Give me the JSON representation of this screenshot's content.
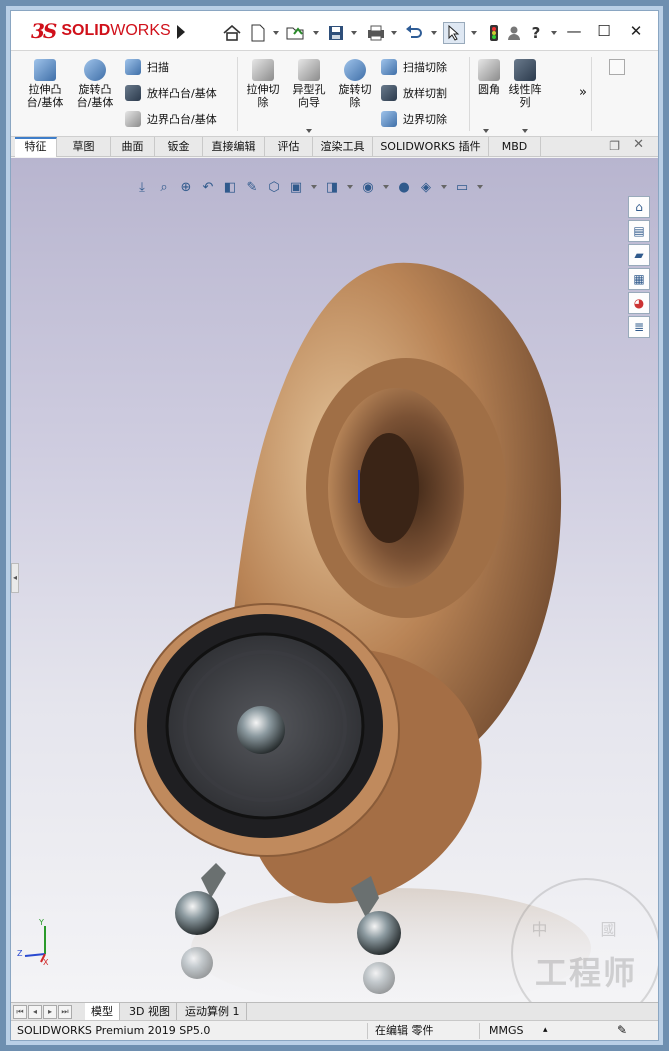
{
  "app": {
    "logo_mark": "3S",
    "logo_text_bold": "SOLID",
    "logo_text_light": "WORKS"
  },
  "quick_access": {
    "icons": [
      "home-icon",
      "new-document-icon",
      "open-icon",
      "save-icon",
      "print-icon",
      "undo-icon",
      "select-icon",
      "traffic-light-icon",
      "user-icon",
      "help-icon",
      "search-icon"
    ],
    "help_glyph": "?"
  },
  "window": {
    "minimize": "—",
    "maximize": "☐",
    "close": "✕"
  },
  "ribbon": {
    "extrude_boss": "拉伸凸\n台/基体",
    "revolve_boss": "旋转凸\n台/基体",
    "sweep": "扫描",
    "loft_boss": "放样凸台/基体",
    "boundary_boss": "边界凸台/基体",
    "extrude_cut": "拉伸切\n除",
    "hole_wizard": "异型孔\n向导",
    "revolve_cut": "旋转切\n除",
    "swept_cut": "扫描切除",
    "lofted_cut": "放样切割",
    "boundary_cut": "边界切除",
    "fillet": "圆角",
    "linear_pattern": "线性阵\n列",
    "expand": "»"
  },
  "tabs": [
    {
      "label": "特征",
      "active": true
    },
    {
      "label": "草图",
      "active": false
    },
    {
      "label": "曲面",
      "active": false
    },
    {
      "label": "钣金",
      "active": false
    },
    {
      "label": "直接编辑",
      "active": false
    },
    {
      "label": "评估",
      "active": false
    },
    {
      "label": "渲染工具",
      "active": false
    },
    {
      "label": "SOLIDWORKS 插件",
      "active": false
    },
    {
      "label": "MBD",
      "active": false
    }
  ],
  "viewport": {
    "triad_x": "X",
    "triad_y": "Y",
    "triad_z": "Z",
    "watermark_top": "中 國",
    "watermark_main": "工程师"
  },
  "bottom_tabs": [
    {
      "label": "模型",
      "active": true
    },
    {
      "label": "3D 视图",
      "active": false
    },
    {
      "label": "运动算例 1",
      "active": false
    }
  ],
  "status": {
    "product": "SOLIDWORKS Premium 2019 SP5.0",
    "mode": "在编辑 零件",
    "units": "MMGS",
    "units_arrow": "▴"
  }
}
